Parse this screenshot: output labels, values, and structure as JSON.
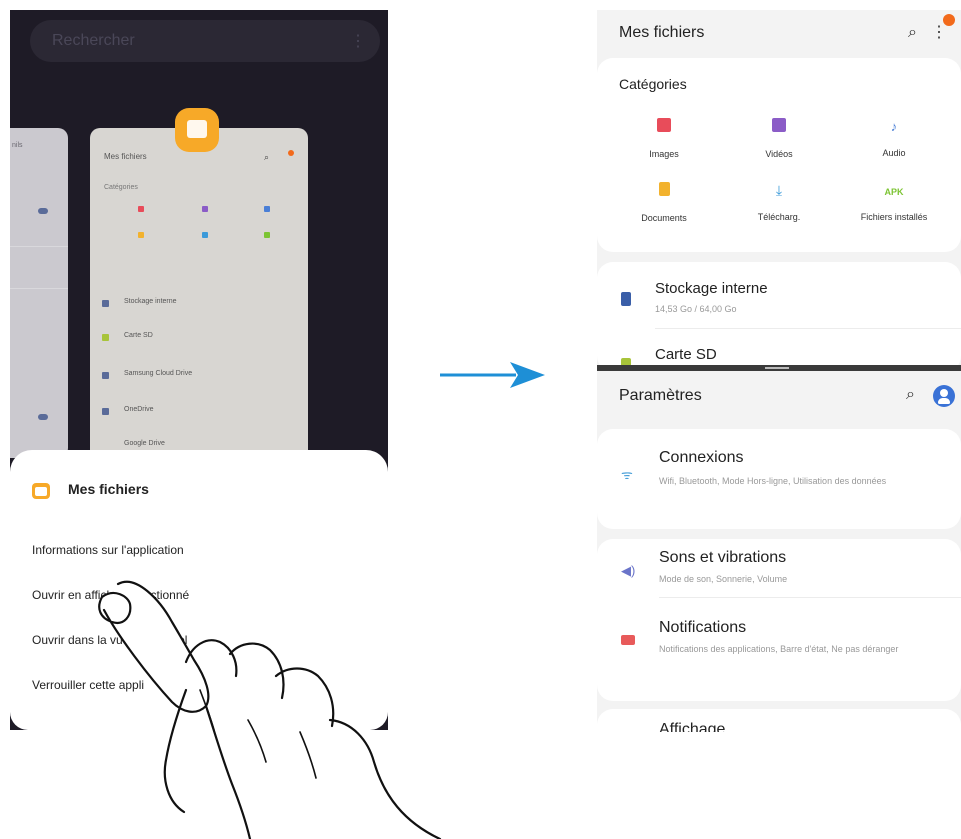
{
  "left_phone": {
    "search_placeholder": "Rechercher",
    "search_menu_icon": "more-vertical-icon",
    "recent_card": {
      "title": "Mes fichiers",
      "categories_heading": "Catégories",
      "storage_items": [
        "Stockage interne",
        "Carte SD",
        "Samsung Cloud Drive",
        "OneDrive",
        "Google Drive"
      ]
    },
    "popup": {
      "app_name": "Mes fichiers",
      "items": [
        "Informations sur l'application",
        "Ouvrir en affichage fractionné",
        "Ouvrir dans la vue contextuel",
        "Verrouiller cette appli"
      ]
    }
  },
  "right_phone": {
    "top_app": {
      "title": "Mes fichiers",
      "search_icon": "search-icon",
      "menu_icon": "more-vertical-icon",
      "categories_heading": "Catégories",
      "categories": [
        {
          "label": "Images",
          "icon": "image-icon",
          "color": "#e84c5a"
        },
        {
          "label": "Vidéos",
          "icon": "video-icon",
          "color": "#8b5cc7"
        },
        {
          "label": "Audio",
          "icon": "music-icon",
          "color": "#4a7fd6"
        },
        {
          "label": "Documents",
          "icon": "document-icon",
          "color": "#f2b22e"
        },
        {
          "label": "Télécharg.",
          "icon": "download-icon",
          "color": "#3b9ad9"
        },
        {
          "label": "Fichiers installés",
          "icon": "apk-icon",
          "color": "#7cc433"
        }
      ],
      "storage": [
        {
          "name": "Stockage interne",
          "sub": "14,53 Go / 64,00 Go",
          "color": "#3a5ea8"
        },
        {
          "name": "Carte SD",
          "sub": "",
          "color": "#a8c43a"
        }
      ]
    },
    "bottom_app": {
      "title": "Paramètres",
      "search_icon": "search-icon",
      "account_icon": "account-icon",
      "items": [
        {
          "name": "Connexions",
          "sub": "Wifi, Bluetooth, Mode Hors-ligne, Utilisation des données",
          "icon": "wifi-icon",
          "color": "#4aa0d8"
        },
        {
          "name": "Sons et vibrations",
          "sub": "Mode de son, Sonnerie, Volume",
          "icon": "volume-icon",
          "color": "#6a74c9"
        },
        {
          "name": "Notifications",
          "sub": "Notifications des applications, Barre d'état, Ne pas déranger",
          "icon": "notification-icon",
          "color": "#e85a5a"
        },
        {
          "name": "Affichage",
          "sub": "",
          "icon": "display-icon",
          "color": "#f2b22e"
        }
      ]
    }
  },
  "colors": {
    "accent_orange": "#f7a928",
    "arrow_blue": "#1e8fd6",
    "left_bg": "#1e1b26"
  }
}
